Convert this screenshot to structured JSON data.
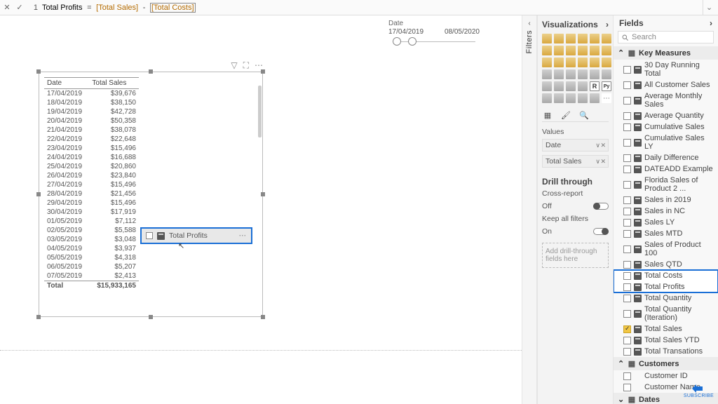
{
  "formula_bar": {
    "line": "1",
    "measure_name": "Total Profits",
    "eq": "=",
    "ref1": "[Total Sales]",
    "minus": "-",
    "ref2": "[Total Costs]"
  },
  "filters_rail_label": "Filters",
  "viz_pane": {
    "title": "Visualizations",
    "values_label": "Values",
    "wells": [
      {
        "label": "Date"
      },
      {
        "label": "Total Sales"
      }
    ],
    "drill_header": "Drill through",
    "cross_report_label": "Cross-report",
    "cross_report_state": "Off",
    "keep_filters_label": "Keep all filters",
    "keep_filters_state": "On",
    "drill_drop_placeholder": "Add drill-through fields here"
  },
  "fields_pane": {
    "title": "Fields",
    "search_placeholder": "Search",
    "tables": [
      {
        "name": "Key Measures",
        "expanded": true,
        "fields": [
          {
            "label": "30 Day Running Total",
            "checked": false,
            "calc": true
          },
          {
            "label": "All Customer Sales",
            "checked": false,
            "calc": true
          },
          {
            "label": "Average Monthly Sales",
            "checked": false,
            "calc": true
          },
          {
            "label": "Average Quantity",
            "checked": false,
            "calc": true
          },
          {
            "label": "Cumulative Sales",
            "checked": false,
            "calc": true
          },
          {
            "label": "Cumulative Sales LY",
            "checked": false,
            "calc": true
          },
          {
            "label": "Daily Difference",
            "checked": false,
            "calc": true
          },
          {
            "label": "DATEADD Example",
            "checked": false,
            "calc": true
          },
          {
            "label": "Florida Sales of Product 2 ...",
            "checked": false,
            "calc": true
          },
          {
            "label": "Sales in 2019",
            "checked": false,
            "calc": true
          },
          {
            "label": "Sales in NC",
            "checked": false,
            "calc": true
          },
          {
            "label": "Sales LY",
            "checked": false,
            "calc": true
          },
          {
            "label": "Sales MTD",
            "checked": false,
            "calc": true
          },
          {
            "label": "Sales of Product 100",
            "checked": false,
            "calc": true
          },
          {
            "label": "Sales QTD",
            "checked": false,
            "calc": true
          },
          {
            "label": "Total Costs",
            "checked": false,
            "calc": true,
            "highlight": true
          },
          {
            "label": "Total Profits",
            "checked": false,
            "calc": true,
            "highlight": true
          },
          {
            "label": "Total Quantity",
            "checked": false,
            "calc": true
          },
          {
            "label": "Total Quantity (Iteration)",
            "checked": false,
            "calc": true
          },
          {
            "label": "Total Sales",
            "checked": true,
            "calc": true
          },
          {
            "label": "Total Sales YTD",
            "checked": false,
            "calc": true
          },
          {
            "label": "Total Transations",
            "checked": false,
            "calc": true
          }
        ]
      },
      {
        "name": "Customers",
        "expanded": true,
        "fields": [
          {
            "label": "Customer ID",
            "checked": false,
            "calc": false
          },
          {
            "label": "Customer Name",
            "checked": false,
            "calc": false
          }
        ]
      },
      {
        "name": "Dates",
        "expanded": false,
        "fields": []
      }
    ]
  },
  "slicer": {
    "title": "Date",
    "start": "17/04/2019",
    "end": "08/05/2020"
  },
  "table_visual": {
    "columns": [
      "Date",
      "Total Sales"
    ],
    "rows": [
      [
        "17/04/2019",
        "$39,676"
      ],
      [
        "18/04/2019",
        "$38,150"
      ],
      [
        "19/04/2019",
        "$42,728"
      ],
      [
        "20/04/2019",
        "$50,358"
      ],
      [
        "21/04/2019",
        "$38,078"
      ],
      [
        "22/04/2019",
        "$22,648"
      ],
      [
        "23/04/2019",
        "$15,496"
      ],
      [
        "24/04/2019",
        "$16,688"
      ],
      [
        "25/04/2019",
        "$20,860"
      ],
      [
        "26/04/2019",
        "$23,840"
      ],
      [
        "27/04/2019",
        "$15,496"
      ],
      [
        "28/04/2019",
        "$21,456"
      ],
      [
        "29/04/2019",
        "$15,496"
      ],
      [
        "30/04/2019",
        "$17,919"
      ],
      [
        "01/05/2019",
        "$7,112"
      ],
      [
        "02/05/2019",
        "$5,588"
      ],
      [
        "03/05/2019",
        "$3,048"
      ],
      [
        "04/05/2019",
        "$3,937"
      ],
      [
        "05/05/2019",
        "$4,318"
      ],
      [
        "06/05/2019",
        "$5,207"
      ],
      [
        "07/05/2019",
        "$2,413"
      ]
    ],
    "total_label": "Total",
    "total_value": "$15,933,165"
  },
  "drag_chip_label": "Total Profits",
  "subscribe_label": "SUBSCRIBE"
}
